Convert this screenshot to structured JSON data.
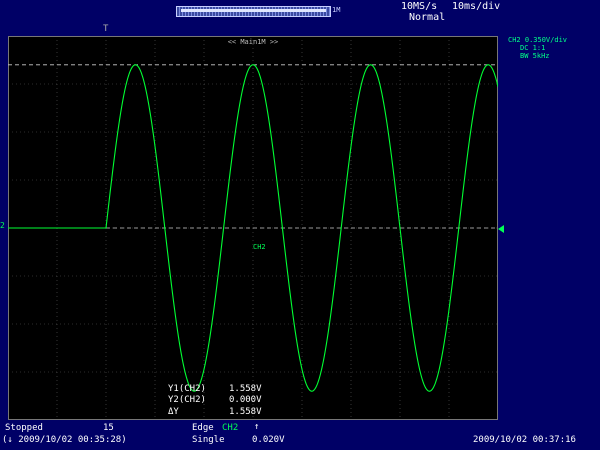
{
  "topbar": {
    "sample_rate": "10MS/s",
    "time_div": "10ms/div",
    "acq_mode": "Normal",
    "memory_label": "1M"
  },
  "screen": {
    "zoom_label": "<< Main1M >>",
    "trace_label": "CH2",
    "trigger_marker": "T",
    "left_marker": "2",
    "trace_color": "#00ff33",
    "grid_color": "#5a5a5a"
  },
  "channel_info": {
    "line1": "CH2  0.350V/div",
    "line2": "DC  1:1",
    "line3": "BW 5kHz"
  },
  "cursors": {
    "y1_label": "Y1(CH2)",
    "y1_value": "1.558V",
    "y2_label": "Y2(CH2)",
    "y2_value": "0.000V",
    "dy_label": "ΔY",
    "dy_value": "1.558V"
  },
  "status": {
    "state": "Stopped",
    "count": "15",
    "trigger_type": "Edge",
    "trigger_source": "CH2",
    "trigger_slope": "↑",
    "trigger_mode": "Single",
    "trigger_level": "0.020V",
    "start_time": "(↓ 2009/10/02 00:35:28)",
    "end_time": "2009/10/02 00:37:16"
  },
  "chart_data": {
    "type": "line",
    "title": "",
    "xlabel": "",
    "ylabel": "",
    "time_per_div_ms": 10,
    "volts_per_div": 0.35,
    "x_divisions": 10,
    "y_divisions": 8,
    "xlim_ms": [
      -50,
      50
    ],
    "ylim_v": [
      -1.4,
      1.4
    ],
    "grid": true,
    "series": [
      {
        "name": "CH2",
        "signal_onset_ms": -30,
        "waveform": "sine",
        "period_ms": 24,
        "amplitude_v": 1.19,
        "offset_v": 0.0,
        "values_note_free": true
      }
    ],
    "cursor_y1_v": 1.558,
    "cursor_y2_v": 0.0
  }
}
